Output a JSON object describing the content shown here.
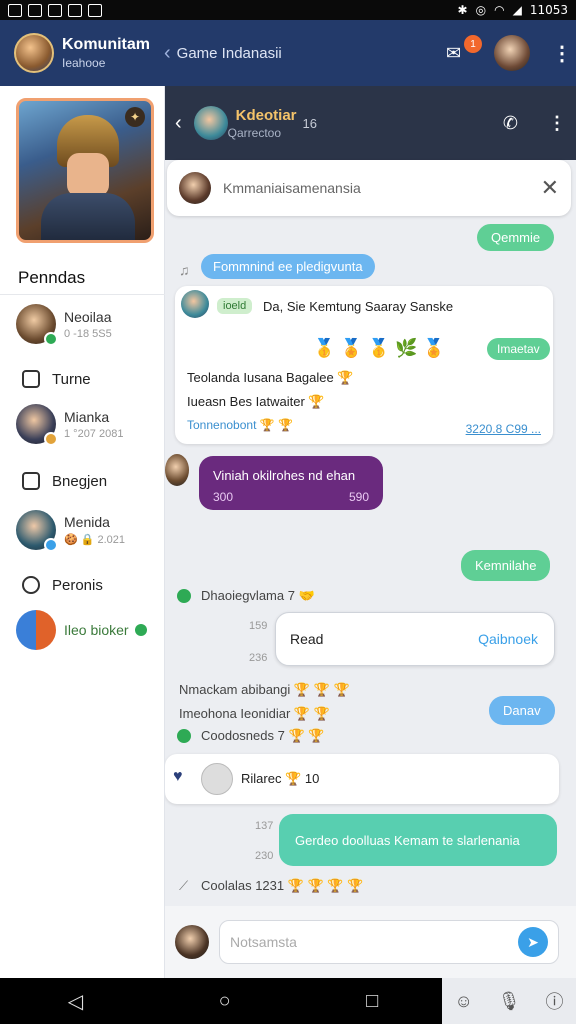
{
  "status_bar": {
    "time": "11053"
  },
  "appbar": {
    "title": "Komunitam",
    "subtitle": "Ieahooe",
    "back_glyph": "‹",
    "section": "Game Indanasii",
    "badge_count": "1",
    "icons": [
      "notification-icon",
      "user-avatar",
      "kebab-menu-icon"
    ]
  },
  "sidebar": {
    "heading": "Penndas",
    "items": [
      {
        "name": "Neoilaa",
        "meta": "0 -18 5S5",
        "type": "contact",
        "color": "#6b4b2f"
      },
      {
        "name": "Turne",
        "type": "link"
      },
      {
        "name": "Mianka",
        "meta": "1 °207 2081",
        "type": "contact",
        "color": "#3a3f58"
      },
      {
        "name": "Bnegjen",
        "type": "link"
      },
      {
        "name": "Menida",
        "meta": "🍪 🔒 2.021",
        "type": "contact",
        "color": "#2d5a6e"
      },
      {
        "name": "Peronis",
        "type": "link"
      },
      {
        "name": "Ileo bioker",
        "type": "contact",
        "color": "#e0622a"
      }
    ]
  },
  "chat": {
    "header": {
      "name": "Kdeotiar",
      "status": "Qarrectoo",
      "count": "16",
      "back_glyph": "‹"
    },
    "search": {
      "text": "Kmmaniaisamenansia",
      "close_glyph": "✕"
    },
    "messages": {
      "green_top": "Qemmie",
      "blue_pill": "Fommnind ee pledigvunta",
      "card1_tag": "ioeld",
      "card1_title": "Da, Sie Kemtung Saaray Sanske",
      "card1_emojis": "🥇 🏅 🥇 🌿 🏅",
      "card1_pill": "Imaetav",
      "card1_line1": "Teolanda Iusana Bagalee 🏆",
      "card1_line2": "Iueasn Bes Iatwaiter 🏆",
      "card1_link": "Tonnenobont 🏆 🏆",
      "card1_code": "3220.8 C99 ...",
      "purple_title": "Viniah okilrohes nd ehan",
      "purple_left": "300",
      "purple_right": "590",
      "green_mid": "Kemnilahe",
      "status1": "Dhaoiegvlama 7 🤝",
      "ts1": "159",
      "read_label": "Read",
      "read_action": "Qaibnoek",
      "ts2": "236",
      "line_a": "Nmackam abibangi 🏆 🏆 🏆",
      "line_b": "Imeohona Ieonidiar 🏆 🏆",
      "status2": "Coodosneds 7 🏆 🏆",
      "blue_right": "Danav",
      "reply_name": "Rilarec 🏆 10",
      "ts3": "137",
      "ts4": "230",
      "teal_msg": "Gerdeo doolluas Kemam te slarlenania",
      "status3": "Coolalas 1231 🏆 🏆 🏆 🏆"
    },
    "input": {
      "placeholder": "Notsamsta",
      "send_glyph": "➤"
    }
  },
  "navbar": {
    "back": "◁",
    "home": "○",
    "recents": "□"
  },
  "colors": {
    "appbar": "#233a6a",
    "chat_header": "#2b3448",
    "green": "#5fcf95",
    "blue": "#6cb6f0",
    "purple": "#6a2a7e",
    "teal": "#58cfb0"
  }
}
